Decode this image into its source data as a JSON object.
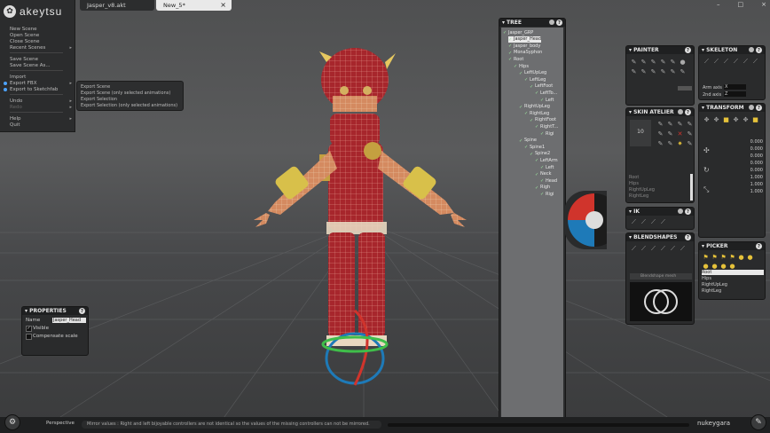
{
  "app": {
    "name": "akeytsu",
    "brand": "nukeygara"
  },
  "tabs": [
    {
      "label": "Jasper_v8.akt"
    },
    {
      "label": "New_5*"
    }
  ],
  "window_controls": [
    "–",
    "□",
    "×"
  ],
  "file_menu": {
    "items": [
      "New Scene",
      "Open Scene",
      "Close Scene",
      "Recent Scenes",
      "Save Scene",
      "Save Scene As...",
      "Import",
      "Export FBX",
      "Export to Sketchfab",
      "Undo",
      "Redo",
      "Help",
      "Quit"
    ],
    "submenu": [
      "Export Scene",
      "Export Scene (only selected animations)",
      "Export Selection",
      "Export Selection (only selected animations)"
    ]
  },
  "tree": {
    "title": "TREE",
    "rows": [
      {
        "label": "Jasper_GRP",
        "indent": 0
      },
      {
        "label": "Jasper_Head",
        "indent": 1,
        "selected": true
      },
      {
        "label": "Jasper_body",
        "indent": 1
      },
      {
        "label": "MonaSyphon",
        "indent": 1
      },
      {
        "label": "Root",
        "indent": 1
      },
      {
        "label": "Hips",
        "indent": 2
      },
      {
        "label": "LeftUpLeg",
        "indent": 3
      },
      {
        "label": "LeftLeg",
        "indent": 4
      },
      {
        "label": "LeftFoot",
        "indent": 5
      },
      {
        "label": "LeftTo...",
        "indent": 6
      },
      {
        "label": "Left",
        "indent": 7
      },
      {
        "label": "RightUpLeg",
        "indent": 3
      },
      {
        "label": "RightLeg",
        "indent": 4
      },
      {
        "label": "RightFoot",
        "indent": 5
      },
      {
        "label": "RightT...",
        "indent": 6
      },
      {
        "label": "Rigi",
        "indent": 7
      },
      {
        "label": "Spine",
        "indent": 3
      },
      {
        "label": "Spine1",
        "indent": 4
      },
      {
        "label": "Spine2",
        "indent": 5
      },
      {
        "label": "LeftArm",
        "indent": 6
      },
      {
        "label": "Left",
        "indent": 7
      },
      {
        "label": "Neck",
        "indent": 6
      },
      {
        "label": "Head",
        "indent": 7
      },
      {
        "label": "Righ",
        "indent": 6
      },
      {
        "label": "Rigi",
        "indent": 7
      }
    ]
  },
  "painter": {
    "title": "PAINTER"
  },
  "skeleton": {
    "title": "SKELETON",
    "arm_axis_label": "Arm axis",
    "arm_axis_value": "X",
    "end_axis_label": "2nd axis",
    "end_axis_value": "Z"
  },
  "skin_atelier": {
    "title": "SKIN ATELIER",
    "value": "10",
    "rows": [
      "Root",
      "Hips",
      "RightUpLeg",
      "RightLeg"
    ]
  },
  "transform": {
    "title": "TRANSFORM",
    "values": [
      "0.000",
      "0.000",
      "0.000",
      "0.000",
      "0.000",
      "1.000",
      "1.000",
      "1.000"
    ]
  },
  "ik": {
    "title": "IK"
  },
  "blendshapes": {
    "title": "BLENDSHAPES",
    "dropdown": "Blendshape mesh"
  },
  "picker": {
    "title": "PICKER",
    "rows": [
      "Root",
      "Hips",
      "RightUpLeg",
      "RightLeg"
    ]
  },
  "properties": {
    "title": "PROPERTIES",
    "name_label": "Name",
    "name_value": "Jasper_Head",
    "visible_label": "Visible",
    "compensate_label": "Compensate scale"
  },
  "status": {
    "view_label": "Perspective",
    "message": "Mirror values : Right and left bijoyable controllers are not identical so the values of the missing controllers can not be mirrored."
  },
  "colors": {
    "panel": "#2a2b2c",
    "header": "#1f2021",
    "tree_bg": "#6d6e70",
    "accent_red": "#d0342c",
    "accent_blue": "#1e7ab8"
  }
}
